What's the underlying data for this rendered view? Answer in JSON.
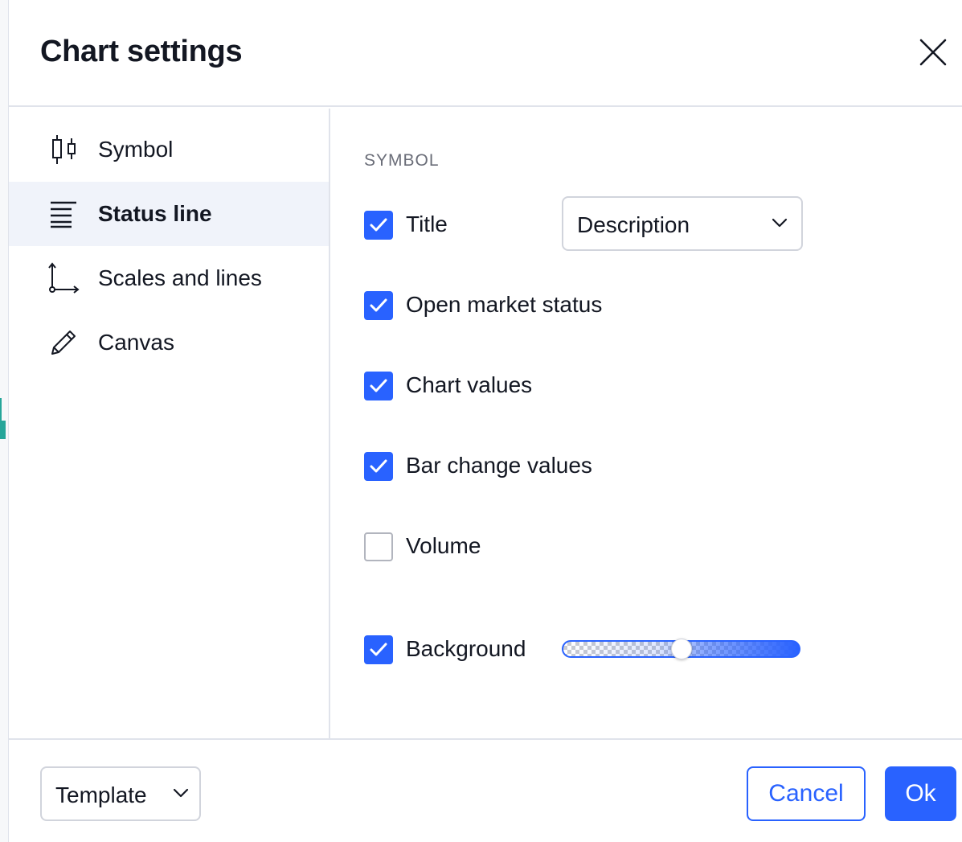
{
  "dialog": {
    "title": "Chart settings",
    "close_icon": "close-icon"
  },
  "sidebar": {
    "items": [
      {
        "label": "Symbol",
        "icon": "candlestick-icon",
        "active": false
      },
      {
        "label": "Status line",
        "icon": "status-line-icon",
        "active": true
      },
      {
        "label": "Scales and lines",
        "icon": "scales-icon",
        "active": false
      },
      {
        "label": "Canvas",
        "icon": "pencil-icon",
        "active": false
      }
    ]
  },
  "content": {
    "section_label": "SYMBOL",
    "options": {
      "title": {
        "label": "Title",
        "checked": true,
        "select_value": "Description"
      },
      "open_market_status": {
        "label": "Open market status",
        "checked": true
      },
      "chart_values": {
        "label": "Chart values",
        "checked": true
      },
      "bar_change_values": {
        "label": "Bar change values",
        "checked": true
      },
      "volume": {
        "label": "Volume",
        "checked": false
      },
      "background": {
        "label": "Background",
        "checked": true,
        "opacity_fraction": 0.5
      }
    }
  },
  "footer": {
    "template_label": "Template",
    "cancel_label": "Cancel",
    "ok_label": "Ok"
  },
  "colors": {
    "accent": "#2962ff",
    "active_nav_bg": "#f0f3fa",
    "border": "#e0e3eb",
    "text": "#131722",
    "muted_text": "#6a6d78"
  }
}
